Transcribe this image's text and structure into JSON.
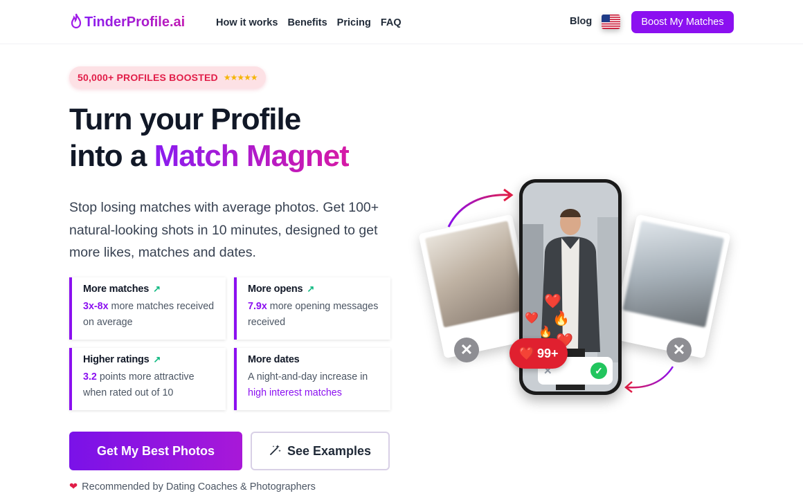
{
  "brand": {
    "name": "TinderProfile.ai"
  },
  "nav": {
    "links": [
      "How it works",
      "Benefits",
      "Pricing",
      "FAQ"
    ],
    "blog": "Blog",
    "cta": "Boost My Matches"
  },
  "badge": {
    "text": "50,000+ PROFILES BOOSTED",
    "stars": "★★★★★"
  },
  "hero": {
    "title_line1": "Turn your Profile",
    "title_line2_prefix": "into a ",
    "title_line2_highlight": "Match Magnet",
    "subtitle": "Stop losing matches with average photos. Get 100+ natural-looking shots in 10 minutes, designed to get more likes, matches and dates."
  },
  "stats": [
    {
      "title": "More matches",
      "highlight": "3x-8x",
      "text": " more matches received on average"
    },
    {
      "title": "More opens",
      "highlight": "7.9x",
      "text": " more opening messages received"
    },
    {
      "title": "Higher ratings",
      "highlight": "3.2",
      "text": " points more attractive when rated out of 10"
    },
    {
      "title": "More dates",
      "text": "A night-and-day increase in ",
      "highlight": "high interest matches"
    }
  ],
  "buttons": {
    "primary": "Get My Best Photos",
    "secondary": "See Examples"
  },
  "recommend": "Recommended by Dating Coaches & Photographers",
  "visual": {
    "count_badge": "99+"
  },
  "colors": {
    "accent": "#8b10f0",
    "pink": "#e11d48"
  }
}
